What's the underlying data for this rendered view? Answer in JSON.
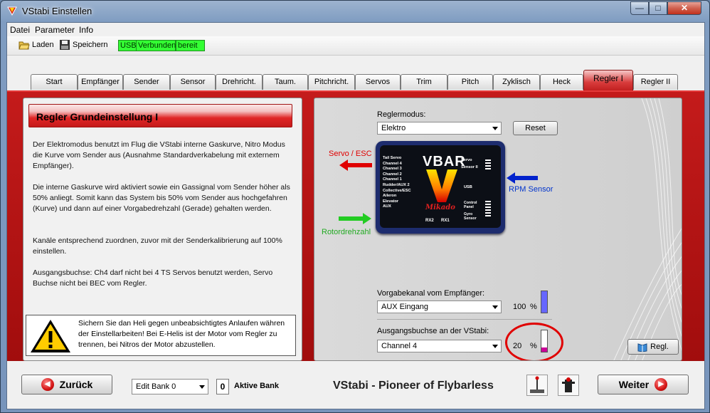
{
  "window": {
    "title": "VStabi Einstellen",
    "minimize": "—",
    "maximize": "□",
    "close": "✕",
    "icon": "vstabi-app-icon"
  },
  "menu": {
    "items": [
      "Datei",
      "Parameter",
      "Info"
    ]
  },
  "toolbar": {
    "load_label": "Laden",
    "save_label": "Speichern",
    "usb_label": "USB",
    "connected_label": "Verbunden",
    "ready_label": "bereit",
    "status_color": "#33ff33"
  },
  "tabs": [
    "Start",
    "Empfänger",
    "Sender",
    "Sensor",
    "Drehricht.",
    "Taum.",
    "Pitchricht.",
    "Servos",
    "Trim",
    "Pitch",
    "Zyklisch",
    "Heck",
    "Regler I",
    "Regler II"
  ],
  "active_tab": "Regler I",
  "left": {
    "heading": "Regler Grundeinstellung I",
    "paragraphs": [
      "Der Elektromodus benutzt im Flug die VStabi interne Gaskurve, Nitro Modus die Kurve vom Sender aus (Ausnahme Standardverkabelung mit externem Empfänger).",
      "Die interne Gaskurve wird aktiviert sowie ein Gassignal vom Sender höher als 50% anliegt. Somit kann das System bis 50% vom Sender aus hochgefahren (Kurve) und dann auf einer Vorgabedrehzahl (Gerade) gehalten werden.",
      "Kanäle entsprechend zuordnen, zuvor mit der Senderkalibrierung auf 100% einstellen.",
      "Ausgangsbuchse: Ch4 darf nicht bei 4 TS Servos benutzt werden, Servo Buchse nicht bei BEC vom Regler."
    ],
    "warning": "Sichern Sie dan Heli gegen unbeabsichtigtes Anlaufen währen der Einstellarbeiten! Bei E-Helis ist der Motor vom Regler zu trennen, bei Nitros der Motor abzustellen."
  },
  "right": {
    "mode_label": "Reglermodus:",
    "mode_value": "Elektro",
    "reset_label": "Reset",
    "servo_esc_label": "Servo / ESC",
    "rpm_sensor_label": "RPM Sensor",
    "rotor_label": "Rotordrehzahl",
    "device": {
      "brand": "VBAR",
      "logo": "Mikado",
      "left_pins": [
        "Tail Servo",
        "Channel 4",
        "Channel 3",
        "Channel 2",
        "Channel 1",
        "Rudder/AUX 2",
        "Collective/ESC",
        "Aileron",
        "Elevator",
        "AUX"
      ],
      "right_pins": [
        "Servo",
        "Sensor II",
        "USB",
        "Control Panel",
        "Gyro Sensor"
      ],
      "bottom_pins": [
        "RX2",
        "RX1"
      ]
    },
    "input_label": "Vorgabekanal vom Empfänger:",
    "input_value": "AUX Eingang",
    "input_percent": "100",
    "input_level": 1.0,
    "input_color": "#6666ff",
    "output_label": "Ausgangsbuchse an der VStabi:",
    "output_value": "Channel 4",
    "output_percent": "20",
    "output_level": 0.2,
    "output_color": "#cc0099",
    "percent_sign": "%",
    "regl_label": "Regl."
  },
  "bottom": {
    "back_label": "Zurück",
    "bank_value": "Edit Bank 0",
    "active_bank_number": "0",
    "active_bank_label": "Aktive Bank",
    "slogan": "VStabi - Pioneer of Flybarless",
    "next_label": "Weiter"
  }
}
